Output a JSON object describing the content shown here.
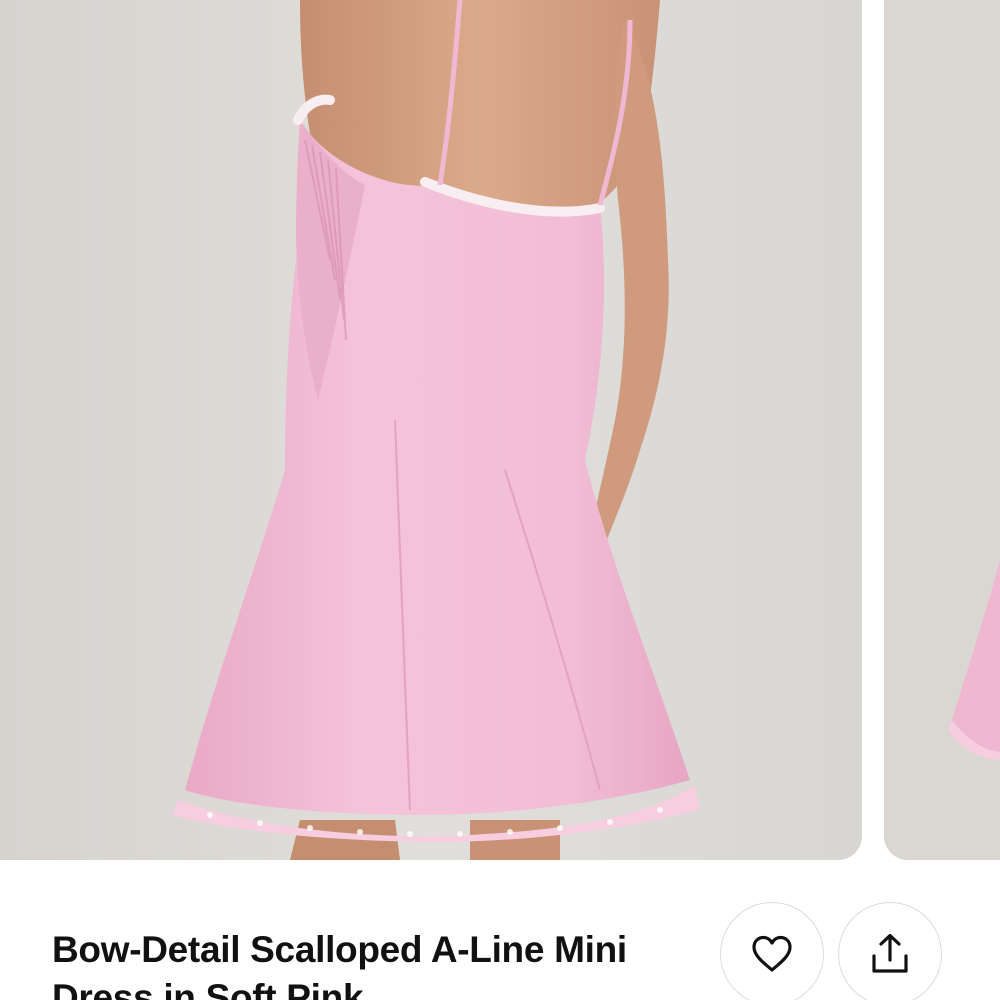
{
  "product": {
    "title": "Bow-Detail Scalloped A-Line Mini Dress in Soft Pink"
  },
  "gallery": {
    "images": [
      {
        "alt": "product-photo-back-view"
      },
      {
        "alt": "product-photo-next"
      }
    ]
  },
  "actions": {
    "favorite_icon": "heart-outline-icon",
    "share_icon": "share-upload-icon"
  },
  "colors": {
    "background": "#ffffff",
    "photo_backdrop": "#dddbd7",
    "dress_pink": "#f3bfd7",
    "text": "#111111",
    "button_border": "#dcdcdc"
  }
}
